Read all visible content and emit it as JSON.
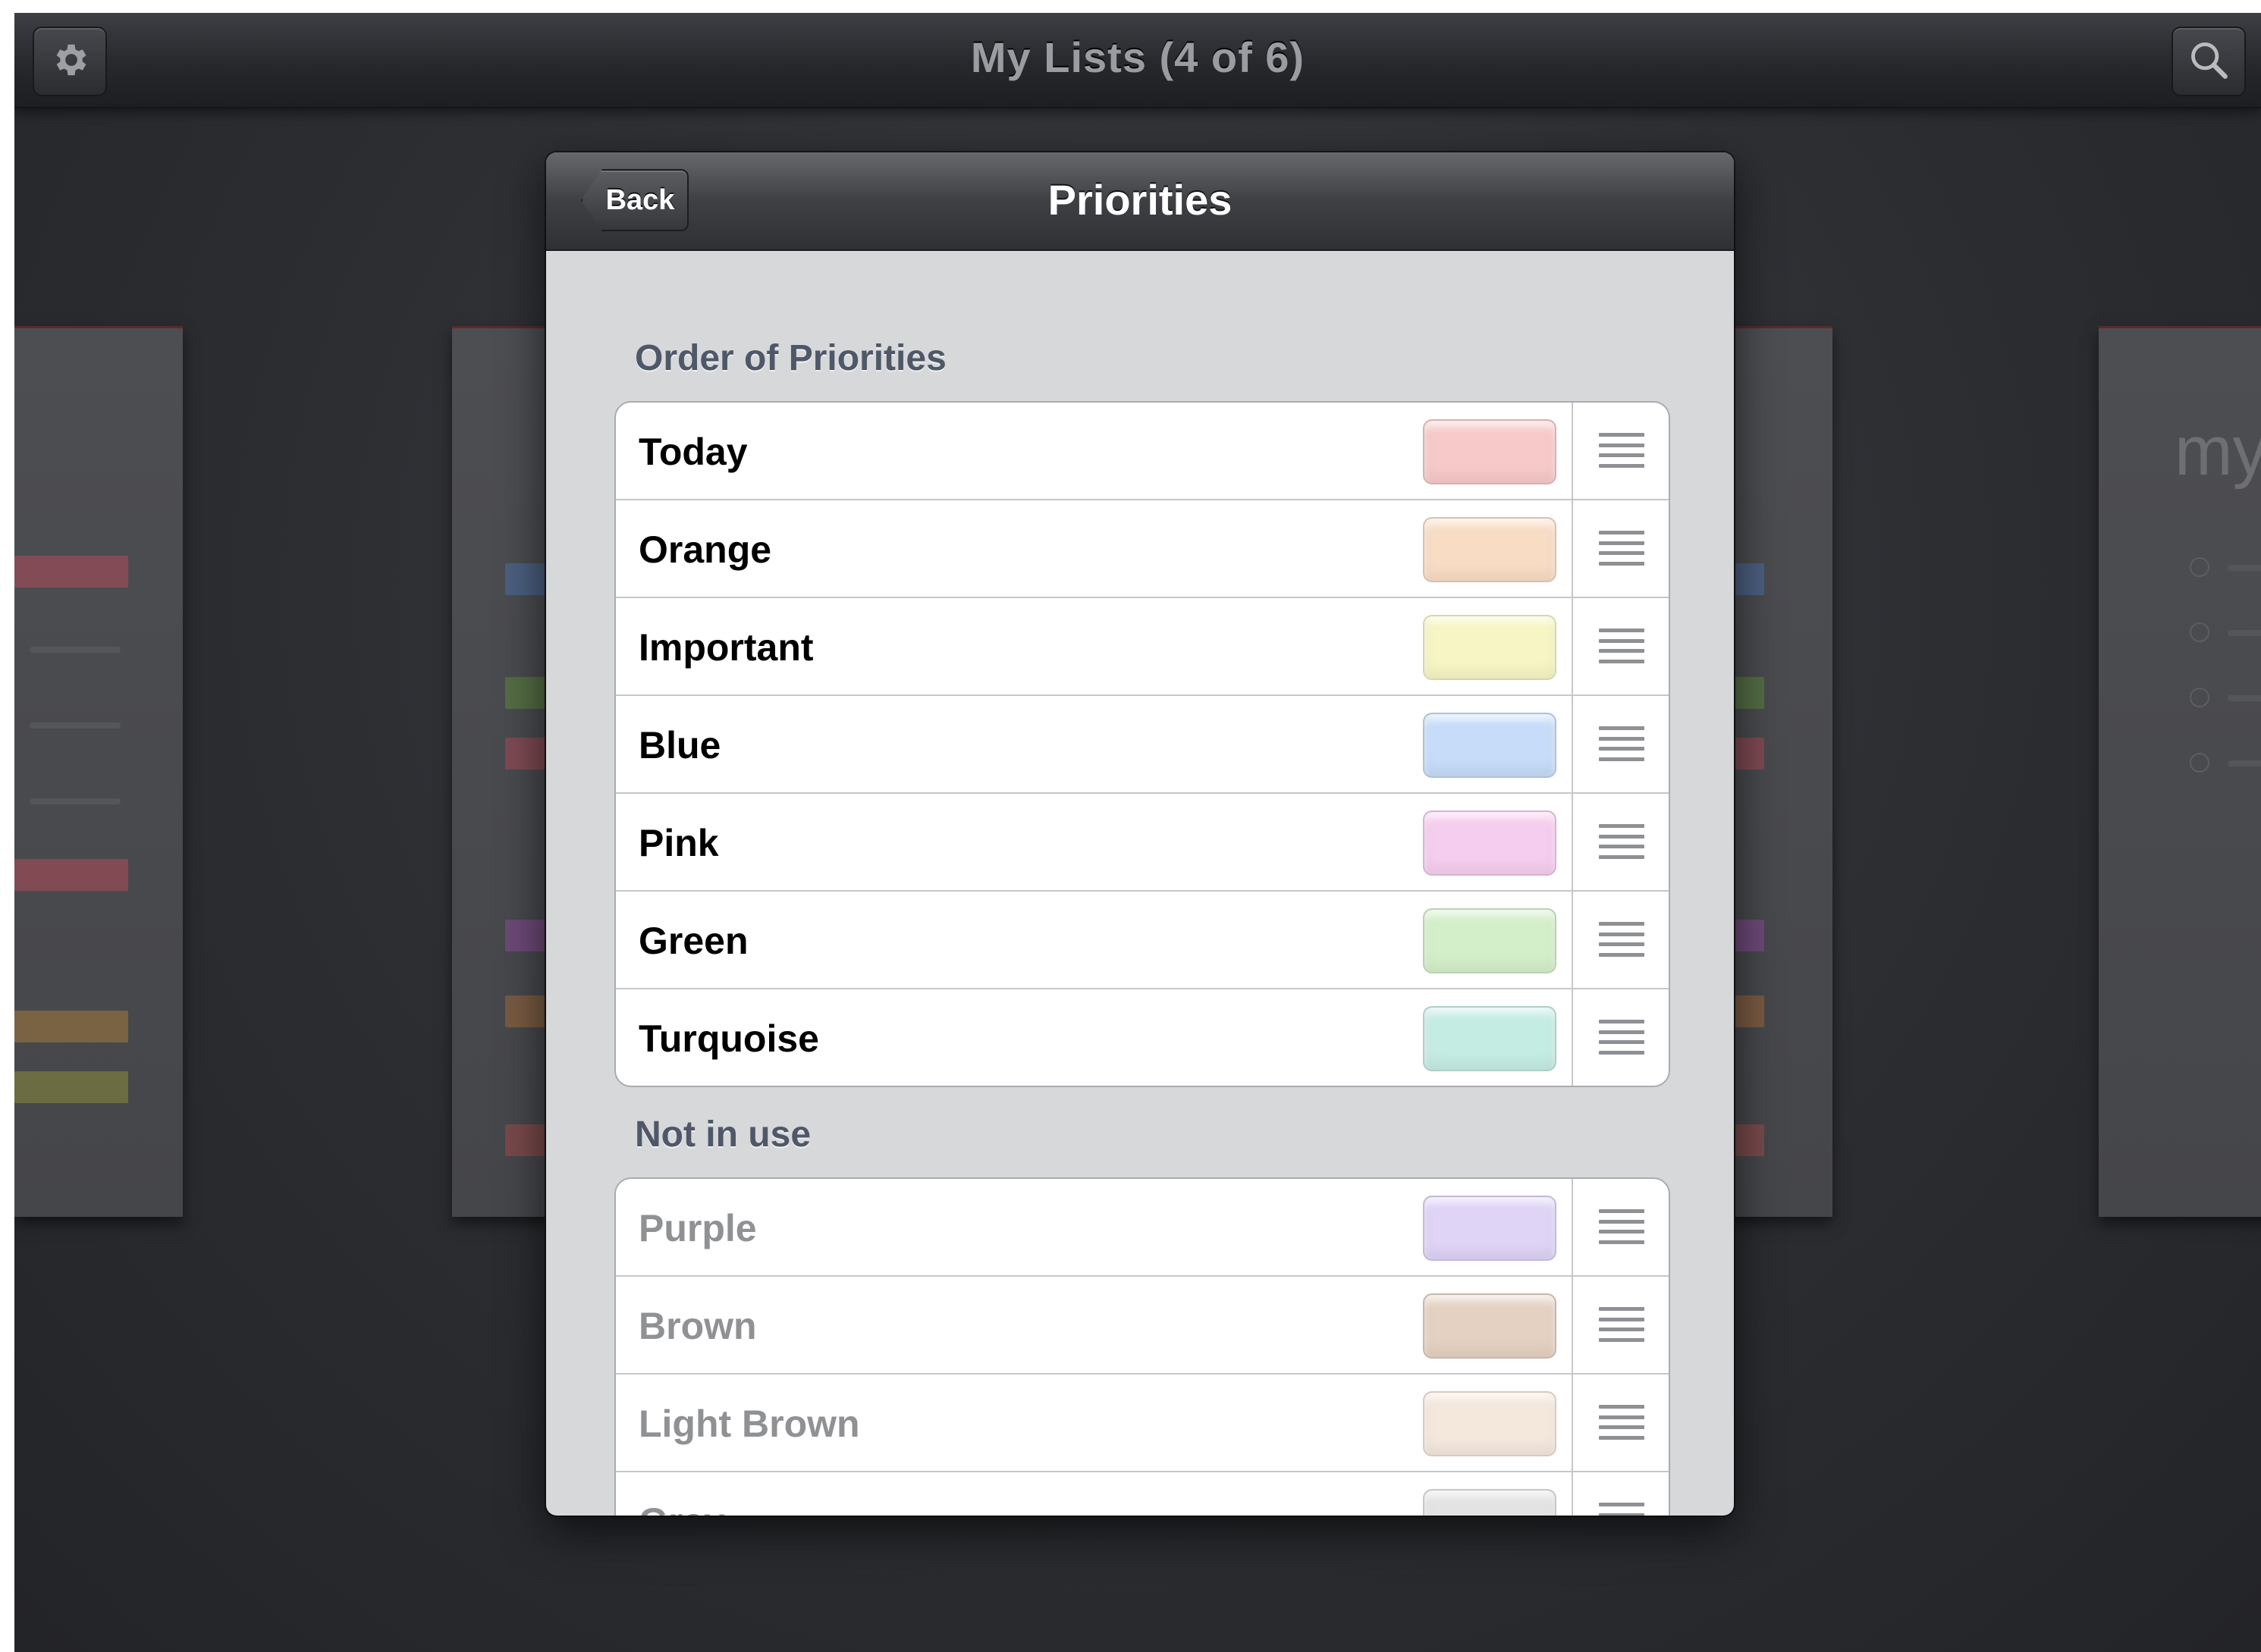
{
  "app": {
    "title": "My Lists (4 of 6)",
    "settings_icon": "gear-icon",
    "search_icon": "magnifier-icon"
  },
  "popover": {
    "title": "Priorities",
    "back_label": "Back",
    "sections": [
      {
        "header": "Order of Priorities",
        "active": true,
        "items": [
          {
            "label": "Today",
            "color": "#f7c9c9"
          },
          {
            "label": "Orange",
            "color": "#f8dcc4"
          },
          {
            "label": "Important",
            "color": "#f6f5c3"
          },
          {
            "label": "Blue",
            "color": "#c6dcf8"
          },
          {
            "label": "Pink",
            "color": "#f5cdee"
          },
          {
            "label": "Green",
            "color": "#d3efc9"
          },
          {
            "label": "Turquoise",
            "color": "#c5ece3"
          }
        ]
      },
      {
        "header": "Not in use",
        "active": false,
        "items": [
          {
            "label": "Purple",
            "color": "#dfd3f6"
          },
          {
            "label": "Brown",
            "color": "#e4d1c2"
          },
          {
            "label": "Light Brown",
            "color": "#f4e7dc"
          },
          {
            "label": "Gray",
            "color": "#e3e3e3"
          }
        ]
      }
    ]
  },
  "background_card_title": "my"
}
